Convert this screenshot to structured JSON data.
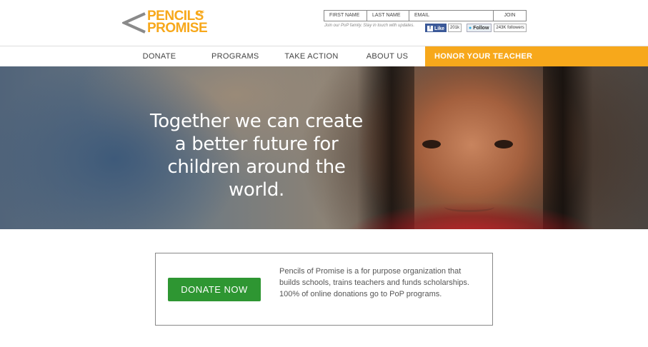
{
  "logo": {
    "line1": "PENCILS",
    "line2": "PROMISE",
    "of": "OF",
    "brand_color": "#f7a81b"
  },
  "signup": {
    "first_name": "FIRST NAME",
    "last_name": "LAST NAME",
    "email": "EMAIL",
    "join_label": "JOIN",
    "tagline": "Join our PoP family. Stay in touch with updates."
  },
  "social": {
    "facebook_label": "Like",
    "facebook_count": "201k",
    "twitter_label": "Follow",
    "twitter_count": "243K followers"
  },
  "nav": {
    "items": [
      {
        "label": "DONATE"
      },
      {
        "label": "PROGRAMS"
      },
      {
        "label": "TAKE ACTION"
      },
      {
        "label": "ABOUT US"
      },
      {
        "label": "HONOR YOUR TEACHER"
      }
    ],
    "highlight_color": "#f7a81b"
  },
  "hero": {
    "headline": "Together we can create a better future for children around the world."
  },
  "donate": {
    "button_label": "DONATE NOW",
    "button_color": "#2e9632",
    "mission": "Pencils of Promise is a for purpose organization that builds schools, trains teachers and funds scholarships. 100% of online donations go to PoP programs."
  }
}
